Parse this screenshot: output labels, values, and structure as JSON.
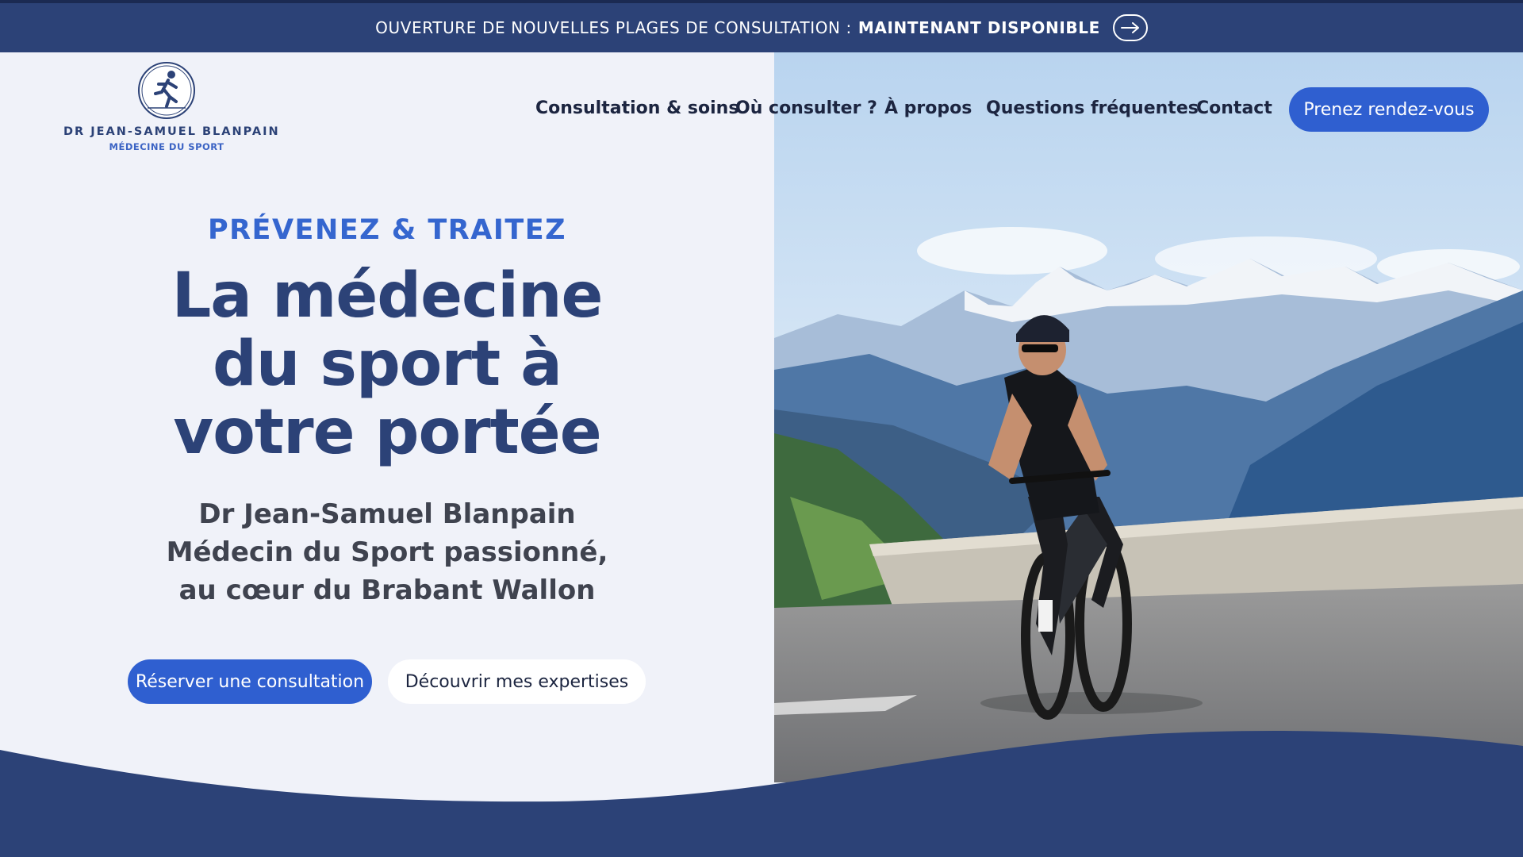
{
  "announcement": {
    "text": "OUVERTURE DE NOUVELLES PLAGES DE CONSULTATION :",
    "highlight": "MAINTENANT DISPONIBLE",
    "icon": "arrow-right-icon"
  },
  "logo": {
    "name": "DR JEAN-SAMUEL BLANPAIN",
    "specialty": "MÉDECINE DU SPORT",
    "icon": "runner-emblem-icon"
  },
  "nav": {
    "items": [
      "Consultation & soins",
      "Où consulter ?",
      "À propos",
      "Questions fréquentes",
      "Contact"
    ],
    "cta": "Prenez rendez-vous"
  },
  "hero": {
    "kicker": "PRÉVENEZ & TRAITEZ",
    "headline": [
      "La médecine",
      "du sport à",
      "votre portée"
    ],
    "subtitle": [
      "Dr Jean-Samuel Blanpain",
      "Médecin du Sport passionné,",
      "au cœur du Brabant Wallon"
    ],
    "primary_button": "Réserver une consultation",
    "secondary_button": "Découvrir mes expertises",
    "photo_alt": "cyclist-on-mountain-road-photo"
  },
  "colors": {
    "navy": "#2c4277",
    "blue_accent": "#2f5fd0",
    "kicker_blue": "#3566cf",
    "background": "#f0f2f9"
  }
}
